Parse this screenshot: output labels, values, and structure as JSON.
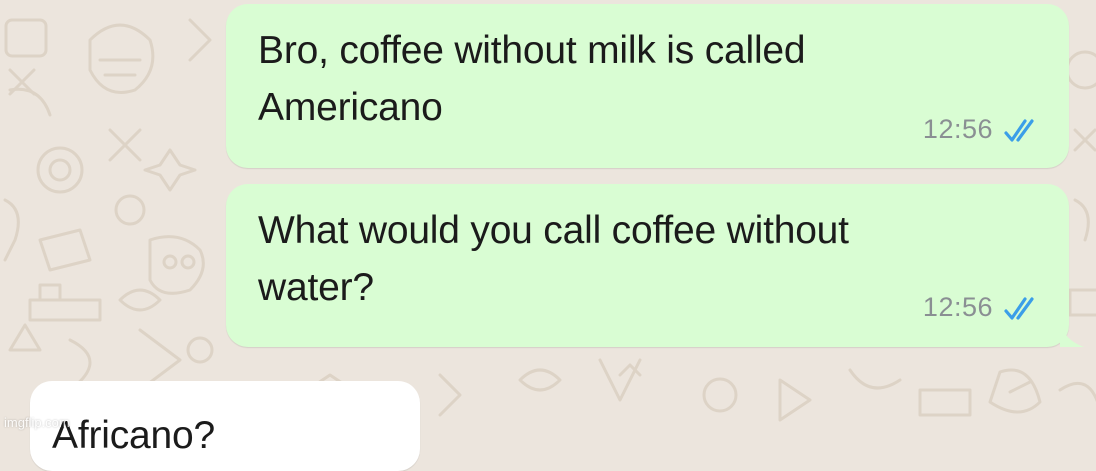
{
  "chat": {
    "messages": [
      {
        "direction": "outgoing",
        "text": "Bro, coffee without milk is called\nAmericano",
        "time": "12:56",
        "status_icon": "double-check-icon"
      },
      {
        "direction": "outgoing",
        "text": "What would you call coffee without\nwater?",
        "time": "12:56",
        "status_icon": "double-check-icon"
      },
      {
        "direction": "incoming",
        "text": "Africano?"
      }
    ]
  },
  "watermark": {
    "text": "imgflip.com"
  },
  "colors": {
    "wallpaper": "#ece5dd",
    "outgoing_bubble": "#d9fdd3",
    "incoming_bubble": "#ffffff",
    "read_ticks": "#3b9ee8",
    "timestamp": "#8a8f93"
  }
}
